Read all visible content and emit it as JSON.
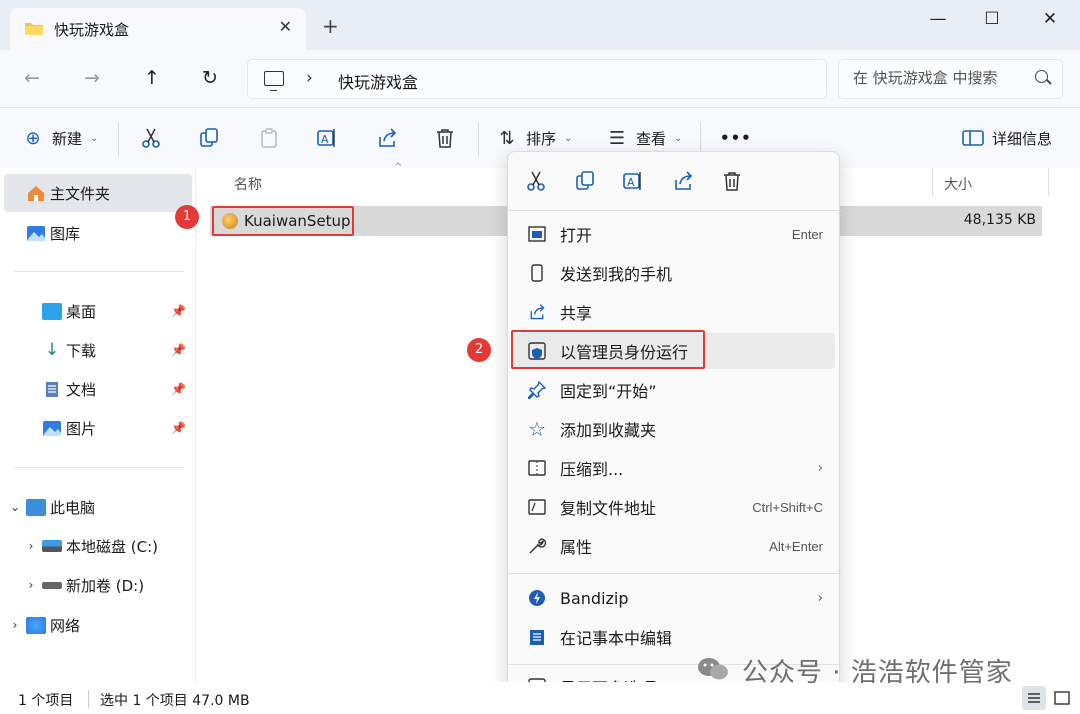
{
  "window": {
    "tab_title": "快玩游戏盒",
    "tab_close": "✕",
    "new_tab": "+",
    "minimize": "—",
    "maximize": "☐",
    "close": "✕"
  },
  "nav": {
    "back": "←",
    "forward": "→",
    "up": "↑",
    "refresh": "↻",
    "crumb_separator": "›",
    "breadcrumb": "快玩游戏盒",
    "search_placeholder": "在 快玩游戏盒 中搜索"
  },
  "toolbar": {
    "new_label": "新建",
    "sort_label": "排序",
    "view_label": "查看",
    "more_label": "•••",
    "details_label": "详细信息"
  },
  "sidebar": {
    "home": "主文件夹",
    "gallery": "图库",
    "desktop": "桌面",
    "downloads": "下载",
    "documents": "文档",
    "pictures": "图片",
    "this_pc": "此电脑",
    "drive_c": "本地磁盘 (C:)",
    "drive_d": "新加卷 (D:)",
    "network": "网络"
  },
  "list": {
    "col_name": "名称",
    "col_size": "大小",
    "file_name": "KuaiwanSetup",
    "file_size": "48,135 KB"
  },
  "badges": {
    "one": "1",
    "two": "2"
  },
  "menu": {
    "open": "打开",
    "open_short": "Enter",
    "send_phone": "发送到我的手机",
    "share": "共享",
    "run_admin": "以管理员身份运行",
    "pin_start": "固定到“开始”",
    "add_fav": "添加到收藏夹",
    "compress": "压缩到...",
    "copy_path": "复制文件地址",
    "copy_path_short": "Ctrl+Shift+C",
    "properties": "属性",
    "properties_short": "Alt+Enter",
    "bandizip": "Bandizip",
    "notepad": "在记事本中编辑",
    "more_options": "显示更多选项",
    "submenu_arrow": "›"
  },
  "status": {
    "count": "1 个项目",
    "selected": "选中 1 个项目  47.0 MB"
  },
  "watermark": "公众号 · 浩浩软件管家",
  "colors": {
    "accent": "#1b5fb5",
    "highlight_red": "#e53935",
    "selection": "#d9d9d9"
  }
}
